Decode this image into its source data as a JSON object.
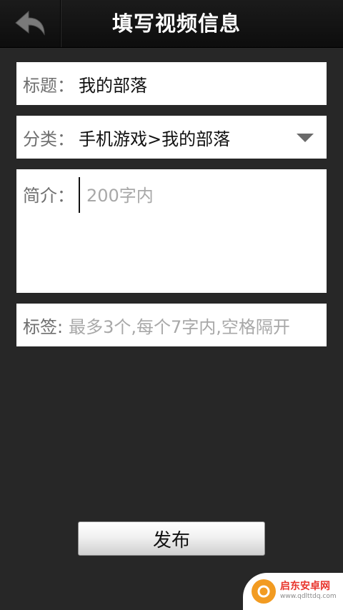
{
  "header": {
    "title": "填写视频信息",
    "back_icon": "back-arrow-icon"
  },
  "form": {
    "title_label": "标题：",
    "title_value": "我的部落",
    "category_label": "分类：",
    "category_value": "手机游戏>我的部落",
    "desc_label": "简介：",
    "desc_placeholder": "200字内",
    "tags_label": "标签:",
    "tags_placeholder": "最多3个,每个7字内,空格隔开"
  },
  "actions": {
    "publish_label": "发布"
  },
  "watermark": {
    "name": "启东安卓网",
    "url": "www.qdlttdq.com"
  }
}
